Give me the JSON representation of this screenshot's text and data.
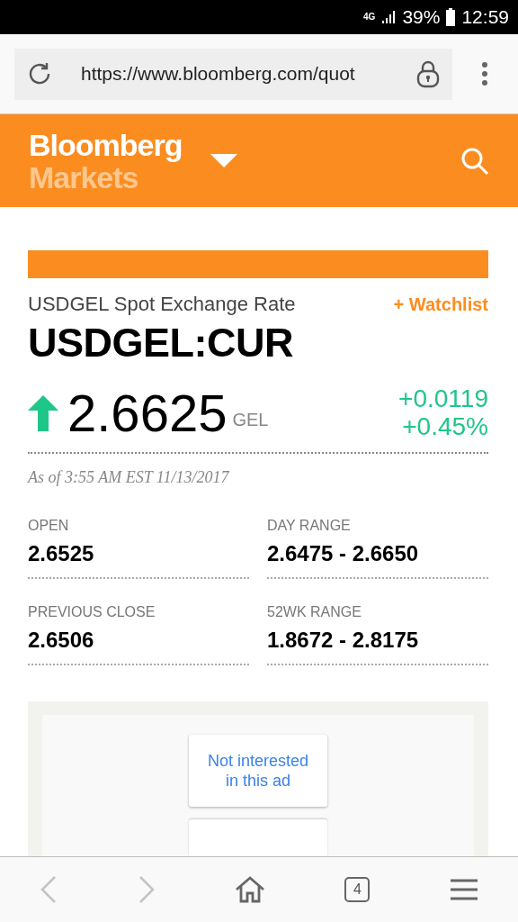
{
  "status_bar": {
    "network": "4G",
    "battery": "39%",
    "time": "12:59"
  },
  "browser": {
    "url": "https://www.bloomberg.com/quot"
  },
  "header": {
    "brand": "Bloomberg",
    "section": "Markets"
  },
  "quote": {
    "subtitle": "USDGEL Spot Exchange Rate",
    "watchlist": "+ Watchlist",
    "ticker": "USDGEL:CUR",
    "rising": true,
    "price": "2.6625",
    "currency": "GEL",
    "change": "+0.0119",
    "change_pct": "+0.45%",
    "as_of": "As of 3:55 AM EST 11/13/2017"
  },
  "stats": [
    {
      "label": "OPEN",
      "value": "2.6525"
    },
    {
      "label": "DAY RANGE",
      "value": "2.6475 - 2.6650"
    },
    {
      "label": "PREVIOUS CLOSE",
      "value": "2.6506"
    },
    {
      "label": "52WK RANGE",
      "value": "1.8672 - 2.8175"
    }
  ],
  "ad": {
    "buttons": [
      "Not interested in this ad"
    ]
  },
  "nav": [
    {
      "kind": "back",
      "disabled": true
    },
    {
      "kind": "forward",
      "disabled": true
    },
    {
      "kind": "home",
      "disabled": false
    },
    {
      "kind": "tabs",
      "disabled": false,
      "count": "4"
    },
    {
      "kind": "menu",
      "disabled": false
    }
  ]
}
